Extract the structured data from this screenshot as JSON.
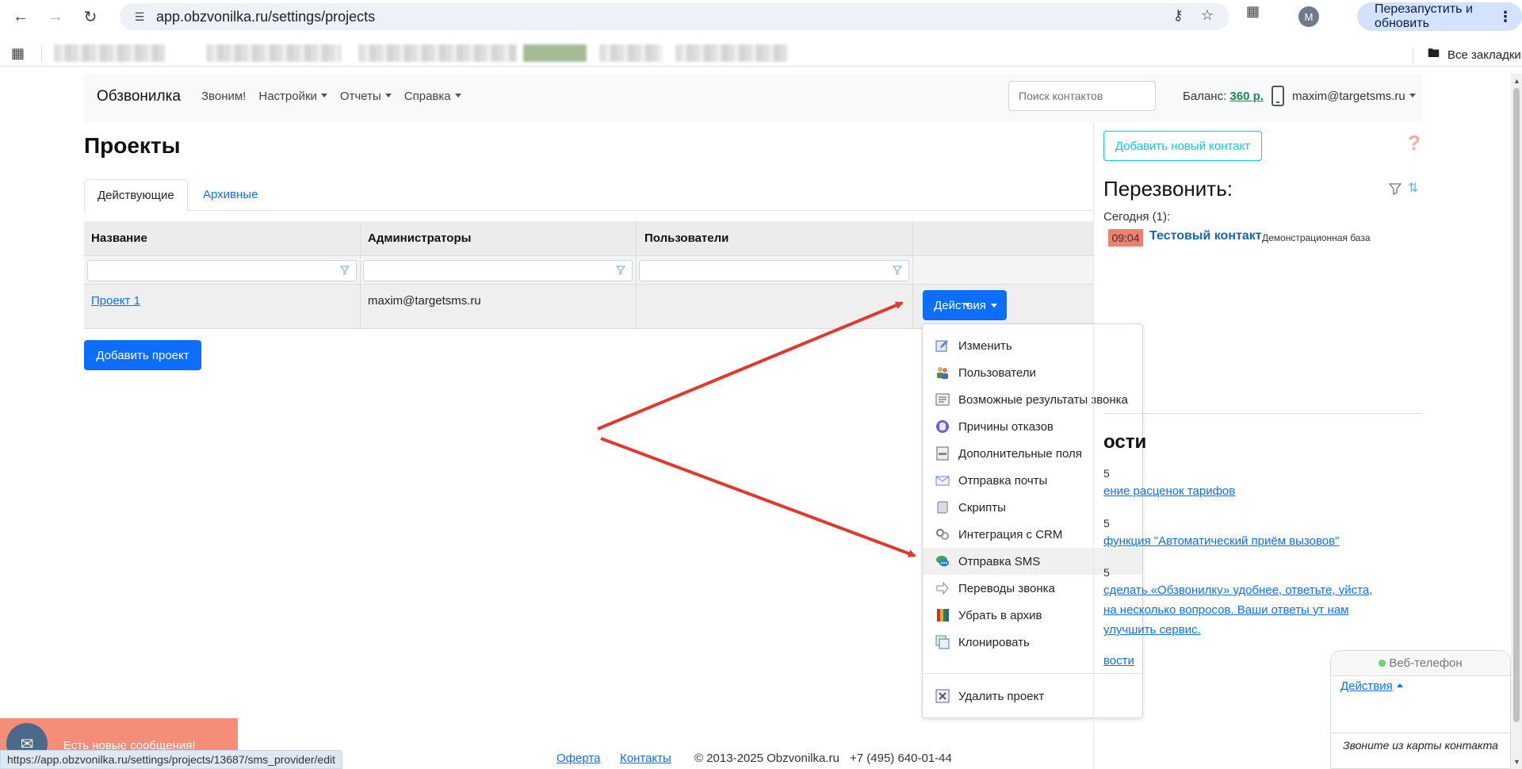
{
  "browser": {
    "url": "app.obzvonilka.ru/settings/projects",
    "relaunch_label": "Перезапустить и обновить",
    "profile_initial": "M",
    "all_bookmarks_label": "Все закладки",
    "status_url": "https://app.obzvonilka.ru/settings/projects/13687/sms_provider/edit"
  },
  "navbar": {
    "brand": "Обзвонилка",
    "links": [
      "Звоним!",
      "Настройки",
      "Отчеты",
      "Справка"
    ],
    "search_placeholder": "Поиск контактов",
    "balance_label": "Баланс:",
    "balance_amount": "360 р.",
    "user_email": "maxim@targetsms.ru"
  },
  "main": {
    "title": "Проекты",
    "tabs": [
      "Действующие",
      "Архивные"
    ],
    "table": {
      "columns": [
        "Название",
        "Администраторы",
        "Пользователи",
        ""
      ],
      "rows": [
        {
          "name": "Проект 1",
          "admins": "maxim@targetsms.ru",
          "users": ""
        }
      ]
    },
    "actions_label": "Действия",
    "add_project_label": "Добавить проект"
  },
  "dropdown": {
    "items": [
      {
        "label": "Изменить",
        "icon": "edit-icon"
      },
      {
        "label": "Пользователи",
        "icon": "users-icon"
      },
      {
        "label": "Возможные результаты звонка",
        "icon": "call-results-icon"
      },
      {
        "label": "Причины отказов",
        "icon": "hand-icon"
      },
      {
        "label": "Дополнительные поля",
        "icon": "fields-icon"
      },
      {
        "label": "Отправка почты",
        "icon": "mail-icon"
      },
      {
        "label": "Скрипты",
        "icon": "script-icon"
      },
      {
        "label": "Интеграция с CRM",
        "icon": "link-icon"
      },
      {
        "label": "Отправка SMS",
        "icon": "sms-icon"
      },
      {
        "label": "Переводы звонка",
        "icon": "transfer-arrow-icon"
      },
      {
        "label": "Убрать в архив",
        "icon": "archive-icon"
      },
      {
        "label": "Клонировать",
        "icon": "clone-icon"
      }
    ],
    "delete_label": "Удалить проект"
  },
  "sidebar": {
    "add_contact_label": "Добавить новый контакт",
    "help_glyph": "?",
    "callback_title": "Перезвонить:",
    "today_label": "Сегодня (1):",
    "callback_time": "09:04",
    "callback_contact": "Тестовый контакт",
    "callback_base": "Демонстрационная база",
    "news_title": "ости",
    "news": [
      {
        "date": "5",
        "text": "ение расценок тарифов"
      },
      {
        "date": "5",
        "text": "функция \"Автоматический приём вызовов\""
      },
      {
        "date": "5",
        "text": "сделать «Обзвонилку» удобнее, ответьте, уйста, на несколько вопросов. Ваши ответы ут нам улучшить сервис."
      }
    ],
    "all_news": "вости"
  },
  "footer": {
    "offer": "Оферта",
    "contacts": "Контакты",
    "copyright": "© 2013-2025 Obzvonilka.ru",
    "phone": "+7 (495) 640-01-44"
  },
  "toast": {
    "text": "Есть новые сообщения!"
  },
  "webphone": {
    "title": "Веб-телефон",
    "actions_label": "Действия",
    "hint": "Звоните из карты контакта"
  },
  "colors": {
    "primary": "#0d6efd",
    "info": "#0dcaf0",
    "success": "#198754",
    "annotation_arrow": "#e03a2f",
    "time_badge": "#f08070"
  }
}
